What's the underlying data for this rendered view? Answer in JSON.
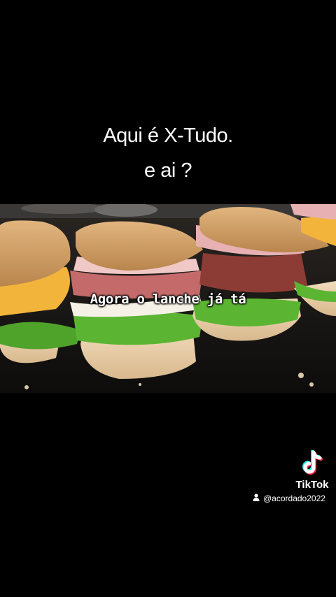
{
  "caption": {
    "line1": "Aqui é X-Tudo.",
    "line2": "e ai ?"
  },
  "video": {
    "subtitle": "Agora o lanche já tá"
  },
  "watermark": {
    "brand": "TikTok",
    "handle": "@acordado2022",
    "logo_icon": "tiktok-note-icon",
    "user_icon": "person-icon"
  },
  "colors": {
    "background": "#000000",
    "text": "#ffffff",
    "tiktok_cyan": "#25f4ee",
    "tiktok_red": "#fe2c55"
  }
}
